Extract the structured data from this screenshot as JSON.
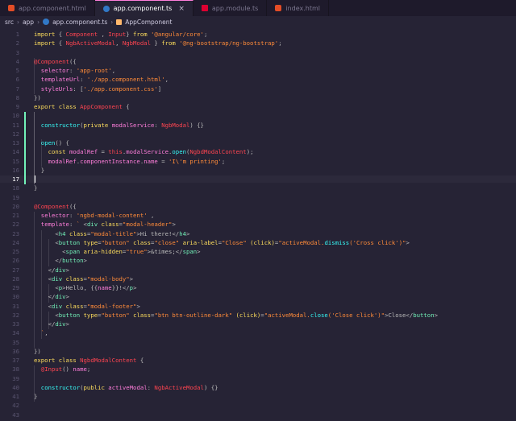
{
  "tabs": [
    {
      "label": "app.component.html",
      "icon": "html-file-icon",
      "active": false
    },
    {
      "label": "app.component.ts",
      "icon": "typescript-file-icon",
      "active": true
    },
    {
      "label": "app.module.ts",
      "icon": "angular-file-icon",
      "active": false
    },
    {
      "label": "index.html",
      "icon": "html-file-icon",
      "active": false
    }
  ],
  "close_glyph": "×",
  "breadcrumb": {
    "parts": [
      "src",
      "app",
      "app.component.ts",
      "AppComponent"
    ],
    "sep": "›"
  },
  "editor": {
    "current_line": 17,
    "colors": {
      "plain": "#bbbbbb",
      "keyword": "#fede5d",
      "string": "#ff8b39",
      "decorator": "#fe4450",
      "type": "#fe4450",
      "func": "#36f9f6",
      "prop": "#ff7edb",
      "tag": "#72f1b8",
      "attr": "#fede5d",
      "this": "#fe4450",
      "punct": "#bbbbbb",
      "number": "#f97e72"
    },
    "lines": [
      [
        [
          "keyword",
          "import"
        ],
        [
          "plain",
          " { "
        ],
        [
          "type",
          "Component"
        ],
        [
          "plain",
          " , "
        ],
        [
          "type",
          "Input"
        ],
        [
          "plain",
          "} "
        ],
        [
          "keyword",
          "from"
        ],
        [
          "plain",
          " "
        ],
        [
          "string",
          "'@angular/core'"
        ],
        [
          "plain",
          ";"
        ]
      ],
      [
        [
          "keyword",
          "import"
        ],
        [
          "plain",
          " { "
        ],
        [
          "type",
          "NgbActiveModal"
        ],
        [
          "plain",
          ", "
        ],
        [
          "type",
          "NgbModal"
        ],
        [
          "plain",
          " } "
        ],
        [
          "keyword",
          "from"
        ],
        [
          "plain",
          " "
        ],
        [
          "string",
          "'@ng-bootstrap/ng-bootstrap'"
        ],
        [
          "plain",
          ";"
        ]
      ],
      [],
      [
        [
          "decorator",
          "@Component"
        ],
        [
          "plain",
          "({"
        ]
      ],
      [
        [
          "plain",
          "  "
        ],
        [
          "prop",
          "selector"
        ],
        [
          "plain",
          ": "
        ],
        [
          "string",
          "'app-root'"
        ],
        [
          "plain",
          ","
        ]
      ],
      [
        [
          "plain",
          "  "
        ],
        [
          "prop",
          "templateUrl"
        ],
        [
          "plain",
          ": "
        ],
        [
          "string",
          "'./app.component.html'"
        ],
        [
          "plain",
          ","
        ]
      ],
      [
        [
          "plain",
          "  "
        ],
        [
          "prop",
          "styleUrls"
        ],
        [
          "plain",
          ": ["
        ],
        [
          "string",
          "'./app.component.css'"
        ],
        [
          "plain",
          "]"
        ]
      ],
      [
        [
          "plain",
          "})"
        ]
      ],
      [
        [
          "keyword",
          "export"
        ],
        [
          "plain",
          " "
        ],
        [
          "keyword",
          "class"
        ],
        [
          "plain",
          " "
        ],
        [
          "type",
          "AppComponent"
        ],
        [
          "plain",
          " {"
        ]
      ],
      [],
      [
        [
          "plain",
          "  "
        ],
        [
          "func",
          "constructor"
        ],
        [
          "plain",
          "("
        ],
        [
          "keyword",
          "private"
        ],
        [
          "plain",
          " "
        ],
        [
          "prop",
          "modalService"
        ],
        [
          "plain",
          ": "
        ],
        [
          "type",
          "NgbModal"
        ],
        [
          "plain",
          ") {}"
        ]
      ],
      [],
      [
        [
          "plain",
          "  "
        ],
        [
          "func",
          "open"
        ],
        [
          "plain",
          "() {"
        ]
      ],
      [
        [
          "plain",
          "    "
        ],
        [
          "keyword",
          "const"
        ],
        [
          "plain",
          " "
        ],
        [
          "prop",
          "modalRef"
        ],
        [
          "plain",
          " = "
        ],
        [
          "this",
          "this"
        ],
        [
          "plain",
          "."
        ],
        [
          "prop",
          "modalService"
        ],
        [
          "plain",
          "."
        ],
        [
          "func",
          "open"
        ],
        [
          "plain",
          "("
        ],
        [
          "type",
          "NgbdModalContent"
        ],
        [
          "plain",
          ");"
        ]
      ],
      [
        [
          "plain",
          "    "
        ],
        [
          "prop",
          "modalRef"
        ],
        [
          "plain",
          "."
        ],
        [
          "prop",
          "componentInstance"
        ],
        [
          "plain",
          "."
        ],
        [
          "prop",
          "name"
        ],
        [
          "plain",
          " = "
        ],
        [
          "string",
          "'I\\'m printing'"
        ],
        [
          "plain",
          ";"
        ]
      ],
      [
        [
          "plain",
          "  }"
        ]
      ],
      [],
      [
        [
          "plain",
          "}"
        ]
      ],
      [],
      [
        [
          "decorator",
          "@Component"
        ],
        [
          "plain",
          "({"
        ]
      ],
      [
        [
          "plain",
          "  "
        ],
        [
          "prop",
          "selector"
        ],
        [
          "plain",
          ": "
        ],
        [
          "string",
          "'ngbd-modal-content'"
        ],
        [
          "plain",
          " ,"
        ]
      ],
      [
        [
          "plain",
          "  "
        ],
        [
          "prop",
          "template"
        ],
        [
          "plain",
          ": "
        ],
        [
          "string",
          "`"
        ],
        [
          "plain",
          " <"
        ],
        [
          "tag",
          "div"
        ],
        [
          "plain",
          " "
        ],
        [
          "attr",
          "class"
        ],
        [
          "plain",
          "="
        ],
        [
          "string",
          "\"modal-header\""
        ],
        [
          "plain",
          ">"
        ]
      ],
      [
        [
          "plain",
          "      <"
        ],
        [
          "tag",
          "h4"
        ],
        [
          "plain",
          " "
        ],
        [
          "attr",
          "class"
        ],
        [
          "plain",
          "="
        ],
        [
          "string",
          "\"modal-title\""
        ],
        [
          "plain",
          ">Hi there!</"
        ],
        [
          "tag",
          "h4"
        ],
        [
          "plain",
          ">"
        ]
      ],
      [
        [
          "plain",
          "      <"
        ],
        [
          "tag",
          "button"
        ],
        [
          "plain",
          " "
        ],
        [
          "attr",
          "type"
        ],
        [
          "plain",
          "="
        ],
        [
          "string",
          "\"button\""
        ],
        [
          "plain",
          " "
        ],
        [
          "attr",
          "class"
        ],
        [
          "plain",
          "="
        ],
        [
          "string",
          "\"close\""
        ],
        [
          "plain",
          " "
        ],
        [
          "attr",
          "aria-label"
        ],
        [
          "plain",
          "="
        ],
        [
          "string",
          "\"Close\""
        ],
        [
          "plain",
          " "
        ],
        [
          "attr",
          "(click)"
        ],
        [
          "plain",
          "="
        ],
        [
          "string",
          "\"activeModal."
        ],
        [
          "func",
          "dismiss"
        ],
        [
          "string",
          "('Cross click')\""
        ],
        [
          "plain",
          ">"
        ]
      ],
      [
        [
          "plain",
          "        <"
        ],
        [
          "tag",
          "span"
        ],
        [
          "plain",
          " "
        ],
        [
          "attr",
          "aria-hidden"
        ],
        [
          "plain",
          "="
        ],
        [
          "string",
          "\"true\""
        ],
        [
          "plain",
          ">&times;</"
        ],
        [
          "tag",
          "span"
        ],
        [
          "plain",
          ">"
        ]
      ],
      [
        [
          "plain",
          "      </"
        ],
        [
          "tag",
          "button"
        ],
        [
          "plain",
          ">"
        ]
      ],
      [
        [
          "plain",
          "    </"
        ],
        [
          "tag",
          "div"
        ],
        [
          "plain",
          ">"
        ]
      ],
      [
        [
          "plain",
          "    <"
        ],
        [
          "tag",
          "div"
        ],
        [
          "plain",
          " "
        ],
        [
          "attr",
          "class"
        ],
        [
          "plain",
          "="
        ],
        [
          "string",
          "\"modal-body\""
        ],
        [
          "plain",
          ">"
        ]
      ],
      [
        [
          "plain",
          "      <"
        ],
        [
          "tag",
          "p"
        ],
        [
          "plain",
          ">Hello, {{"
        ],
        [
          "prop",
          "name"
        ],
        [
          "plain",
          "}}!</"
        ],
        [
          "tag",
          "p"
        ],
        [
          "plain",
          ">"
        ]
      ],
      [
        [
          "plain",
          "    </"
        ],
        [
          "tag",
          "div"
        ],
        [
          "plain",
          ">"
        ]
      ],
      [
        [
          "plain",
          "    <"
        ],
        [
          "tag",
          "div"
        ],
        [
          "plain",
          " "
        ],
        [
          "attr",
          "class"
        ],
        [
          "plain",
          "="
        ],
        [
          "string",
          "\"modal-footer\""
        ],
        [
          "plain",
          ">"
        ]
      ],
      [
        [
          "plain",
          "      <"
        ],
        [
          "tag",
          "button"
        ],
        [
          "plain",
          " "
        ],
        [
          "attr",
          "type"
        ],
        [
          "plain",
          "="
        ],
        [
          "string",
          "\"button\""
        ],
        [
          "plain",
          " "
        ],
        [
          "attr",
          "class"
        ],
        [
          "plain",
          "="
        ],
        [
          "string",
          "\"btn btn-outline-dark\""
        ],
        [
          "plain",
          " "
        ],
        [
          "attr",
          "(click)"
        ],
        [
          "plain",
          "="
        ],
        [
          "string",
          "\"activeModal."
        ],
        [
          "func",
          "close"
        ],
        [
          "string",
          "('Close click')\""
        ],
        [
          "plain",
          ">Close</"
        ],
        [
          "tag",
          "button"
        ],
        [
          "plain",
          ">"
        ]
      ],
      [
        [
          "plain",
          "    </"
        ],
        [
          "tag",
          "div"
        ],
        [
          "plain",
          ">"
        ]
      ],
      [
        [
          "plain",
          "  "
        ],
        [
          "string",
          "`"
        ],
        [
          "plain",
          ","
        ]
      ],
      [],
      [
        [
          "plain",
          "})"
        ]
      ],
      [
        [
          "keyword",
          "export"
        ],
        [
          "plain",
          " "
        ],
        [
          "keyword",
          "class"
        ],
        [
          "plain",
          " "
        ],
        [
          "type",
          "NgbdModalContent"
        ],
        [
          "plain",
          " {"
        ]
      ],
      [
        [
          "plain",
          "  "
        ],
        [
          "decorator",
          "@Input"
        ],
        [
          "plain",
          "() "
        ],
        [
          "prop",
          "name"
        ],
        [
          "plain",
          ";"
        ]
      ],
      [],
      [
        [
          "plain",
          "  "
        ],
        [
          "func",
          "constructor"
        ],
        [
          "plain",
          "("
        ],
        [
          "keyword",
          "public"
        ],
        [
          "plain",
          " "
        ],
        [
          "prop",
          "activeModal"
        ],
        [
          "plain",
          ": "
        ],
        [
          "type",
          "NgbActiveModal"
        ],
        [
          "plain",
          ") {}"
        ]
      ],
      [
        [
          "plain",
          "}"
        ]
      ],
      [],
      []
    ]
  }
}
